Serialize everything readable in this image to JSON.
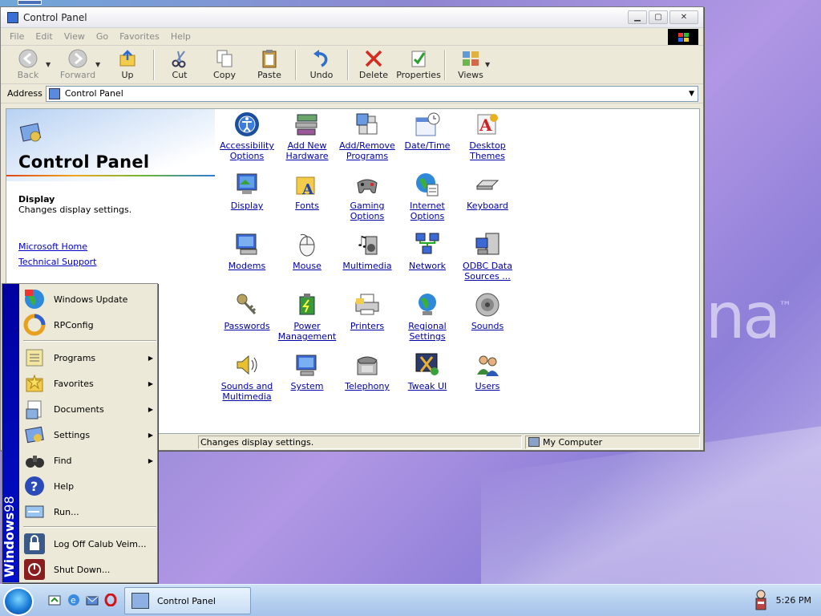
{
  "window": {
    "title": "Control Panel"
  },
  "menu": [
    "File",
    "Edit",
    "View",
    "Go",
    "Favorites",
    "Help"
  ],
  "toolbar": {
    "back": "Back",
    "forward": "Forward",
    "up": "Up",
    "cut": "Cut",
    "copy": "Copy",
    "paste": "Paste",
    "undo": "Undo",
    "delete": "Delete",
    "properties": "Properties",
    "views": "Views"
  },
  "address": {
    "label": "Address",
    "value": "Control Panel"
  },
  "left_panel": {
    "title": "Control Panel",
    "selected_name": "Display",
    "selected_desc": "Changes display settings.",
    "links": [
      "Microsoft Home",
      "Technical Support"
    ]
  },
  "items": [
    {
      "label": "Accessibility\nOptions",
      "icon": "accessibility-icon"
    },
    {
      "label": "Add New\nHardware",
      "icon": "hardware-icon"
    },
    {
      "label": "Add/Remove\nPrograms",
      "icon": "programs-icon"
    },
    {
      "label": "Date/Time",
      "icon": "calendar-icon"
    },
    {
      "label": "Desktop\nThemes",
      "icon": "themes-icon"
    },
    {
      "label": "Display",
      "icon": "monitor-icon"
    },
    {
      "label": "Fonts",
      "icon": "fonts-folder-icon"
    },
    {
      "label": "Gaming\nOptions",
      "icon": "gamepad-icon"
    },
    {
      "label": "Internet\nOptions",
      "icon": "globe-icon"
    },
    {
      "label": "Keyboard",
      "icon": "keyboard-icon"
    },
    {
      "label": "Modems",
      "icon": "modem-icon"
    },
    {
      "label": "Mouse",
      "icon": "mouse-icon"
    },
    {
      "label": "Multimedia",
      "icon": "speaker-music-icon"
    },
    {
      "label": "Network",
      "icon": "network-icon"
    },
    {
      "label": "ODBC Data\nSources ...",
      "icon": "database-icon"
    },
    {
      "label": "Passwords",
      "icon": "keys-icon"
    },
    {
      "label": "Power\nManagement",
      "icon": "battery-icon"
    },
    {
      "label": "Printers",
      "icon": "printer-icon"
    },
    {
      "label": "Regional\nSettings",
      "icon": "regional-globe-icon"
    },
    {
      "label": "Sounds",
      "icon": "speaker-icon"
    },
    {
      "label": "Sounds and\nMultimedia",
      "icon": "sound-icon"
    },
    {
      "label": "System",
      "icon": "system-icon"
    },
    {
      "label": "Telephony",
      "icon": "phone-icon"
    },
    {
      "label": "Tweak UI",
      "icon": "tweakui-icon"
    },
    {
      "label": "Users",
      "icon": "users-icon"
    }
  ],
  "status": {
    "text": "Changes display settings.",
    "location": "My Computer"
  },
  "start_menu": {
    "band_bold": "Windows",
    "band_light": "98",
    "items": [
      {
        "label": "Windows Update",
        "sub": false
      },
      {
        "label": "RPConfig",
        "sub": false
      },
      {
        "label": "Programs",
        "sub": true
      },
      {
        "label": "Favorites",
        "sub": true
      },
      {
        "label": "Documents",
        "sub": true
      },
      {
        "label": "Settings",
        "sub": true
      },
      {
        "label": "Find",
        "sub": true
      },
      {
        "label": "Help",
        "sub": false
      },
      {
        "label": "Run...",
        "sub": false
      },
      {
        "label": "Log Off Calub Veim...",
        "sub": false
      },
      {
        "label": "Shut Down...",
        "sub": false
      }
    ]
  },
  "taskbar": {
    "task": "Control Panel",
    "clock": "5:26 PM"
  },
  "desktop": {
    "logo_text": "na",
    "logo_mark": "™"
  }
}
